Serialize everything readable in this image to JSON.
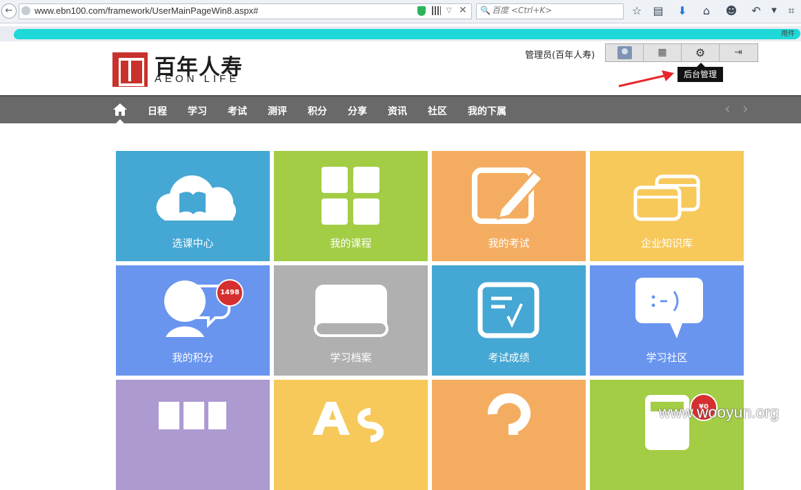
{
  "browser": {
    "url": "www.ebn100.com/framework/UserMainPageWin8.aspx#",
    "search_placeholder": "百度 <Ctrl+K>",
    "scribble_tail": "用件"
  },
  "header": {
    "logo_cn": "百年人寿",
    "logo_en": "AEON LIFE",
    "admin_user": "管理员(百年人寿)",
    "tooltip": "后台管理"
  },
  "nav": {
    "items": [
      "日程",
      "学习",
      "考试",
      "测评",
      "积分",
      "分享",
      "资讯",
      "社区",
      "我的下属"
    ]
  },
  "tiles": [
    {
      "label": "选课中心",
      "color": "#45a7d3"
    },
    {
      "label": "我的课程",
      "color": "#a3cd45"
    },
    {
      "label": "我的考试",
      "color": "#f4ad60"
    },
    {
      "label": "企业知识库",
      "color": "#f7c95b"
    },
    {
      "label": "我的积分",
      "color": "#6995ef",
      "badge": "1498"
    },
    {
      "label": "学习档案",
      "color": "#b0b0b0"
    },
    {
      "label": "考试成绩",
      "color": "#45a7d3"
    },
    {
      "label": "学习社区",
      "color": "#6995ef"
    },
    {
      "label": "",
      "color": "#ad9ad1"
    },
    {
      "label": "",
      "color": "#f7c95b"
    },
    {
      "label": "",
      "color": "#f4ad60"
    },
    {
      "label": "",
      "color": "#a3cd45",
      "badge": "¥0"
    }
  ],
  "colors": {
    "nav_bg": "#696969",
    "accent_red": "#d62f2f",
    "logo_red": "#c8312c"
  },
  "watermark": "www.wooyun.org"
}
